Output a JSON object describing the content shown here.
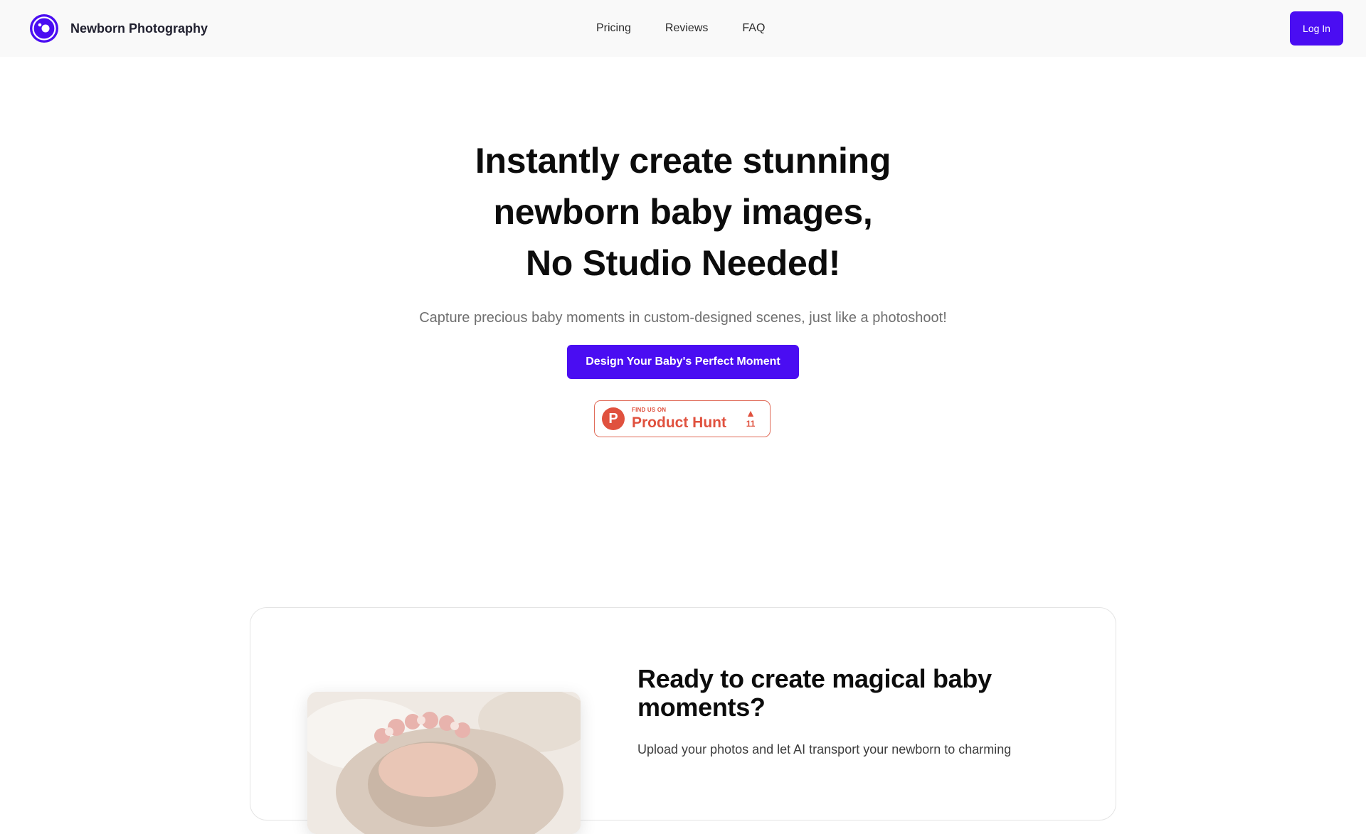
{
  "nav": {
    "brand": "Newborn Photography",
    "links": [
      "Pricing",
      "Reviews",
      "FAQ"
    ],
    "login": "Log In"
  },
  "hero": {
    "title_lines": [
      "Instantly create stunning",
      "newborn baby images,",
      "No Studio Needed!"
    ],
    "subtitle": "Capture precious baby moments in custom-designed scenes, just like a photoshoot!",
    "cta": "Design Your Baby's Perfect Moment"
  },
  "product_hunt": {
    "small": "FIND US ON",
    "big": "Product Hunt",
    "logo_letter": "P",
    "count": "11"
  },
  "card": {
    "title": "Ready to create magical baby moments?",
    "text": "Upload your photos and let AI transport your newborn to charming"
  },
  "colors": {
    "accent": "#4a0df2",
    "product_hunt": "#e0513e"
  }
}
